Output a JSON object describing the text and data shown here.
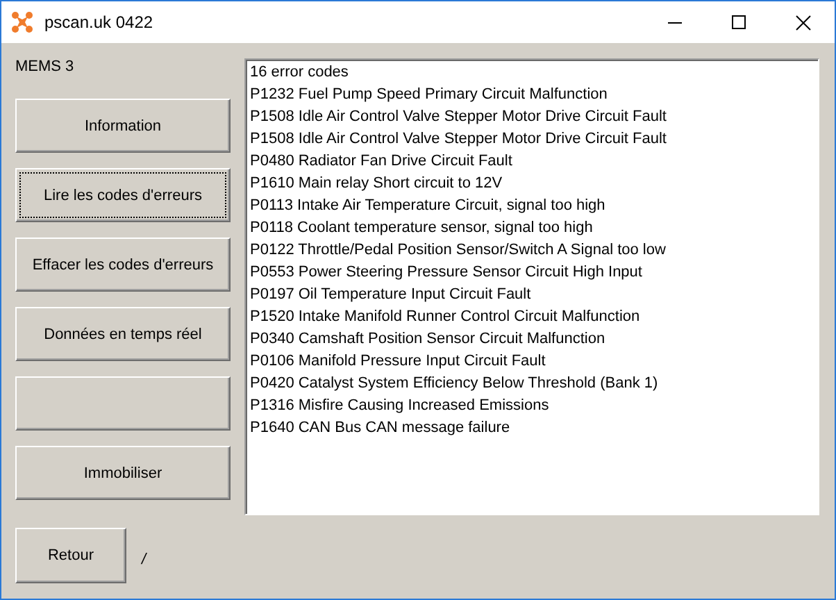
{
  "window": {
    "title": "pscan.uk 0422"
  },
  "ecu_label": "MEMS 3",
  "buttons": [
    {
      "label": "Information",
      "focused": false
    },
    {
      "label": "Lire les codes d'erreurs",
      "focused": true
    },
    {
      "label": "Effacer les codes d'erreurs",
      "focused": false
    },
    {
      "label": "Données en temps réel",
      "focused": false
    },
    {
      "focused": false
    },
    {
      "label": "Immobiliser",
      "focused": false
    }
  ],
  "back_button": {
    "label": "Retour"
  },
  "status": "/",
  "codes_list": [
    "16 error codes",
    "P1232 Fuel Pump Speed Primary Circuit Malfunction",
    "P1508 Idle Air Control Valve Stepper Motor Drive Circuit Fault",
    "P1508 Idle Air Control Valve Stepper Motor Drive Circuit Fault",
    "P0480 Radiator Fan Drive Circuit Fault",
    "P1610 Main relay Short circuit to 12V",
    "P0113 Intake Air Temperature Circuit, signal too high",
    "P0118 Coolant temperature sensor, signal too high",
    "P0122 Throttle/Pedal Position Sensor/Switch A Signal too low",
    "P0553 Power Steering Pressure Sensor Circuit High Input",
    "P0197 Oil Temperature Input Circuit Fault",
    "P1520 Intake Manifold Runner Control Circuit Malfunction",
    "P0340 Camshaft Position Sensor Circuit Malfunction",
    "P0106 Manifold Pressure Input Circuit Fault",
    "P0420 Catalyst System Efficiency Below Threshold (Bank 1)",
    "P1316 Misfire Causing Increased Emissions",
    "P1640 CAN Bus CAN message failure"
  ]
}
